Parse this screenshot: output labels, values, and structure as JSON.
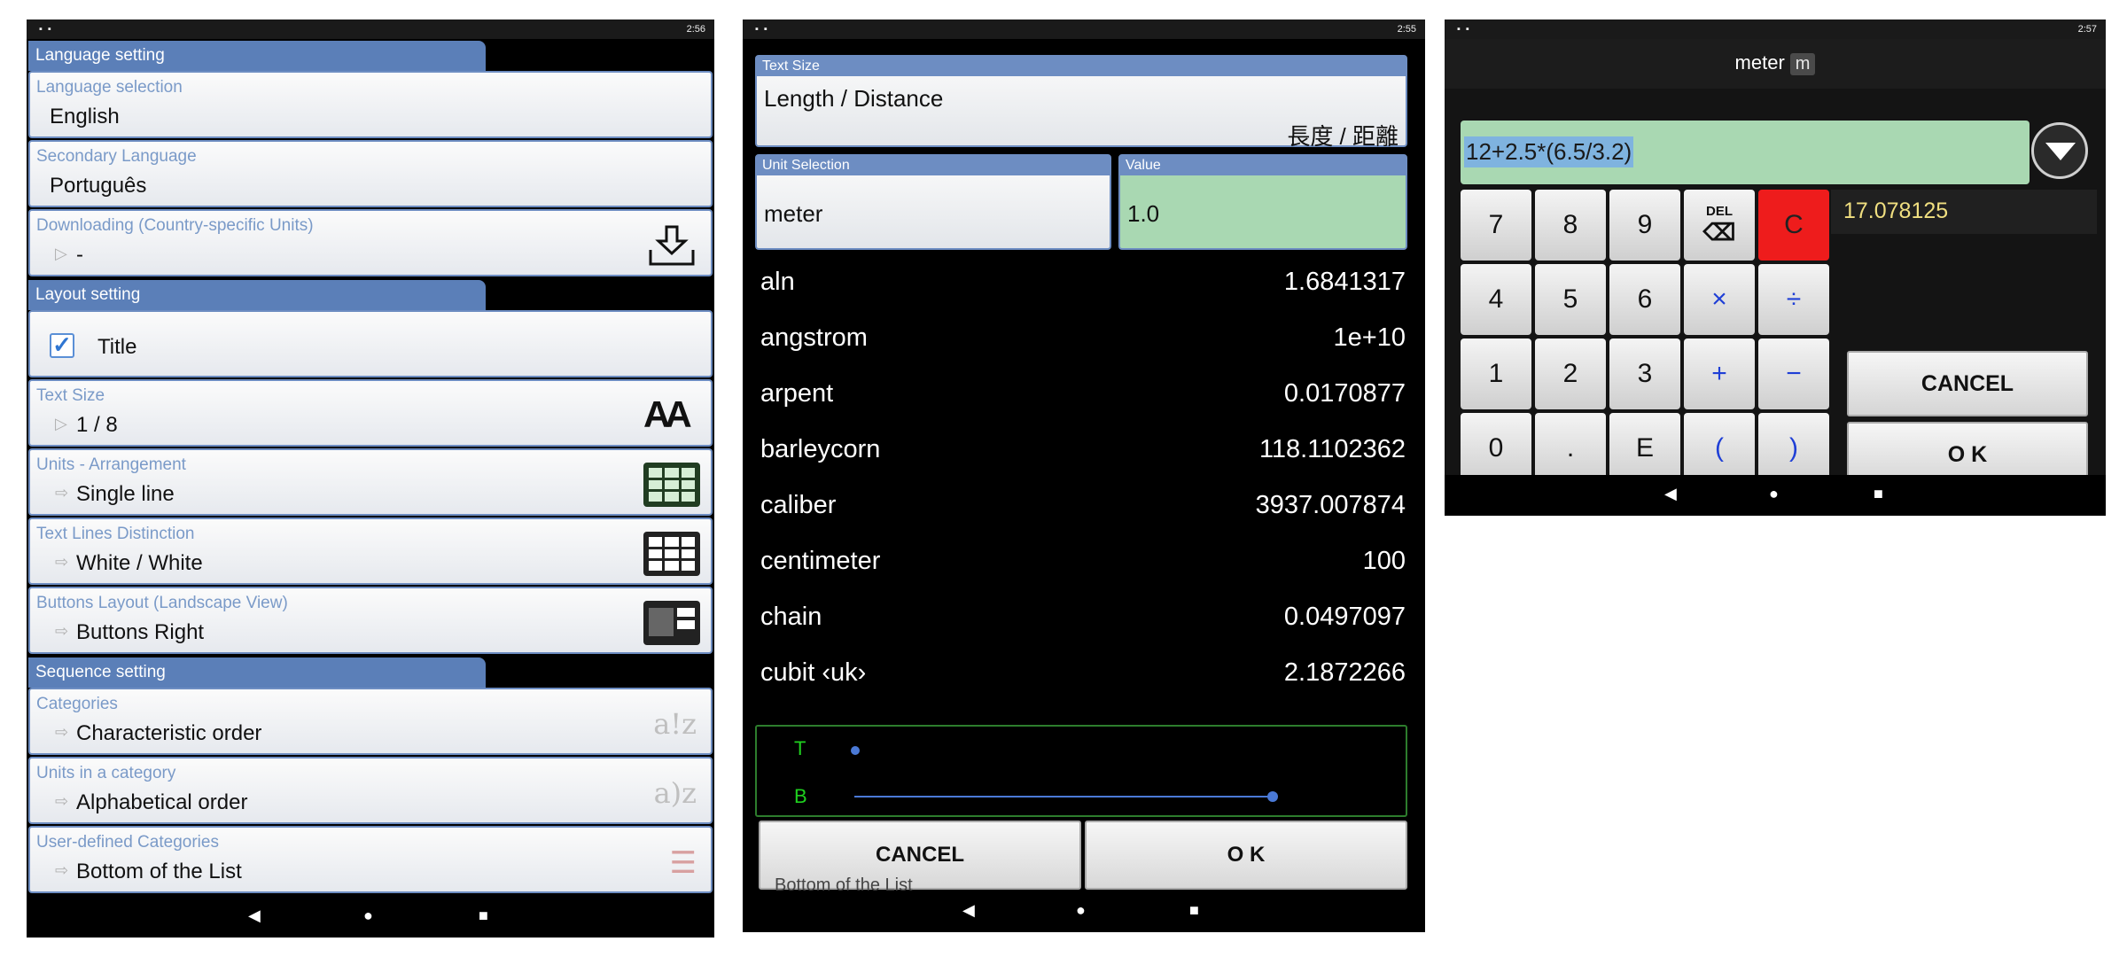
{
  "screen1": {
    "status_time": "2:56",
    "sections": {
      "language": "Language setting",
      "layout": "Layout setting",
      "sequence": "Sequence setting"
    },
    "rows": {
      "language_selection": {
        "label": "Language selection",
        "value": "English"
      },
      "secondary_language": {
        "label": "Secondary Language",
        "value": "Português"
      },
      "downloading": {
        "label": "Downloading (Country-specific Units)",
        "value": "-"
      },
      "title": {
        "value": "Title"
      },
      "text_size": {
        "label": "Text Size",
        "value": "1 / 8"
      },
      "units_arrangement": {
        "label": "Units - Arrangement",
        "value": "Single line"
      },
      "text_lines": {
        "label": "Text Lines Distinction",
        "value": "White / White"
      },
      "buttons_layout": {
        "label": "Buttons Layout (Landscape View)",
        "value": "Buttons Right"
      },
      "categories": {
        "label": "Categories",
        "value": "Characteristic order"
      },
      "units_category": {
        "label": "Units in a category",
        "value": "Alphabetical order"
      },
      "user_defined": {
        "label": "User-defined Categories",
        "value": "Bottom of the List"
      }
    },
    "icons": {
      "text_size_glyph": "AA",
      "az_glyph_1": "a!z",
      "az_glyph_2": "a)z"
    }
  },
  "screen2": {
    "status_time": "2:55",
    "text_size_label": "Text Size",
    "category_en": "Length / Distance",
    "category_cjk": "長度 / 距離",
    "unit_selection_label": "Unit Selection",
    "value_label": "Value",
    "unit": "meter",
    "value": "1.0",
    "units": [
      {
        "name": "aln",
        "value": "1.6841317"
      },
      {
        "name": "angstrom",
        "value": "1e+10"
      },
      {
        "name": "arpent",
        "value": "0.0170877"
      },
      {
        "name": "barleycorn",
        "value": "118.1102362"
      },
      {
        "name": "caliber",
        "value": "3937.007874"
      },
      {
        "name": "centimeter",
        "value": "100"
      },
      {
        "name": "chain",
        "value": "0.0497097"
      },
      {
        "name": "cubit ‹uk›",
        "value": "2.1872266"
      }
    ],
    "graph_t": "T",
    "graph_b": "B",
    "cancel": "CANCEL",
    "ok": "O K",
    "behind_text": "Bottom of the List"
  },
  "screen3": {
    "status_time": "2:57",
    "unit": "meter",
    "unit_symbol": "m",
    "expression": "12+2.5*(6.5/3.2)",
    "result": "17.078125",
    "keys": {
      "k7": "7",
      "k8": "8",
      "k9": "9",
      "del": "DEL",
      "c": "C",
      "k4": "4",
      "k5": "5",
      "k6": "6",
      "mul": "×",
      "div": "÷",
      "k1": "1",
      "k2": "2",
      "k3": "3",
      "plus": "+",
      "minus": "−",
      "k0": "0",
      "dot": ".",
      "e": "E",
      "lparen": "(",
      "rparen": ")"
    },
    "cancel": "CANCEL",
    "ok": "O K"
  },
  "nav": {
    "back": "◀",
    "home": "●",
    "recent": "■"
  },
  "colors": {
    "section_header": "#5b7fb8",
    "row_border": "#6d8dc2",
    "value_field": "#a9d8b2",
    "result_text": "#f0df80",
    "clear_key": "#ee1c1c",
    "graph_green": "#1fd01f"
  }
}
